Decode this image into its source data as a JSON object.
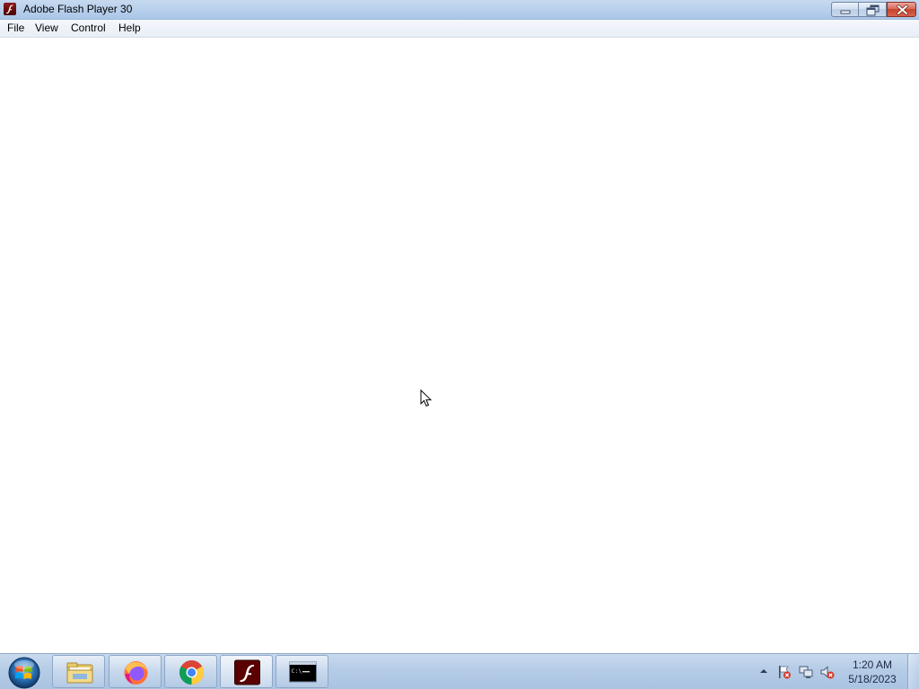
{
  "window": {
    "title": "Adobe Flash Player 30",
    "app_icon": "flash-icon",
    "controls": {
      "minimize_icon": "minimize-icon",
      "restore_icon": "restore-icon",
      "close_icon": "close-icon"
    }
  },
  "menubar": {
    "items": [
      {
        "label": "File"
      },
      {
        "label": "View"
      },
      {
        "label": "Control"
      },
      {
        "label": "Help"
      }
    ]
  },
  "taskbar": {
    "start_icon": "windows-start-icon",
    "pinned": [
      {
        "app": "Windows Explorer",
        "icon": "folder-icon"
      },
      {
        "app": "Firefox",
        "icon": "firefox-icon"
      },
      {
        "app": "Google Chrome",
        "icon": "chrome-icon"
      },
      {
        "app": "Adobe Flash Player",
        "icon": "flash-icon",
        "active": true
      },
      {
        "app": "Command Prompt",
        "icon": "cmd-icon"
      }
    ],
    "tray": {
      "icons": [
        "chevron-up-icon",
        "action-center-flag-icon",
        "network-icon",
        "volume-muted-icon"
      ],
      "time": "1:20 AM",
      "date": "5/18/2023"
    }
  },
  "colors": {
    "titlebar": "#b9d0ec",
    "taskbar": "#b7cde7",
    "content_bg": "#ffffff",
    "close_button": "#c7412a",
    "flash_red": "#7a0a0a"
  }
}
